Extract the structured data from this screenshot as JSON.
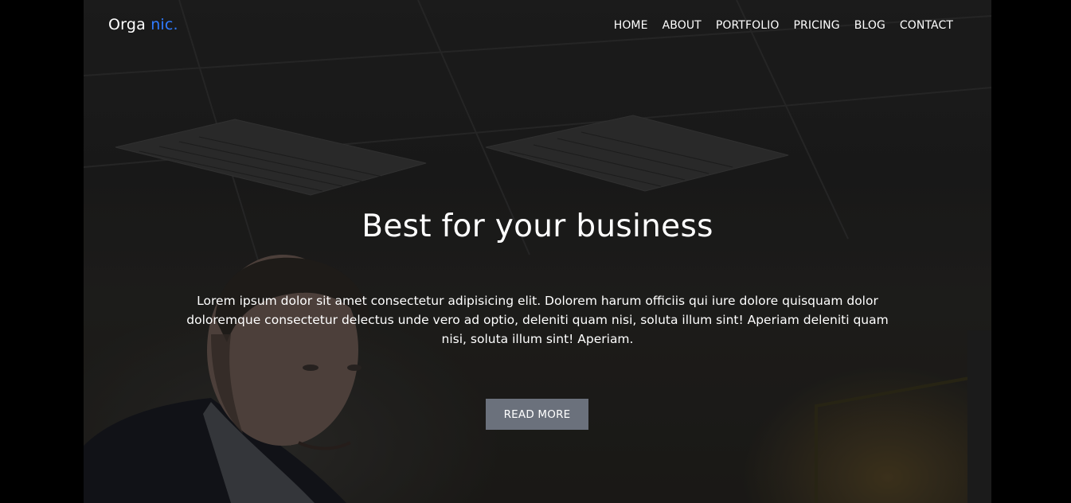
{
  "brand": {
    "name_part1": "Orga",
    "name_part2": "nic.",
    "accent_color": "#2f7bff"
  },
  "nav": {
    "items": [
      {
        "label": "HOME"
      },
      {
        "label": "ABOUT"
      },
      {
        "label": "PORTFOLIO"
      },
      {
        "label": "PRICING"
      },
      {
        "label": "BLOG"
      },
      {
        "label": "CONTACT"
      }
    ]
  },
  "hero": {
    "title": "Best for your business",
    "text": "Lorem ipsum dolor sit amet consectetur adipisicing elit. Dolorem harum officiis qui iure dolore quisquam dolor doloremque consectetur delectus unde vero ad optio, deleniti quam nisi, soluta illum sint! Aperiam deleniti quam nisi, soluta illum sint! Aperiam.",
    "button_label": "READ MORE",
    "button_color": "#6b717c"
  }
}
